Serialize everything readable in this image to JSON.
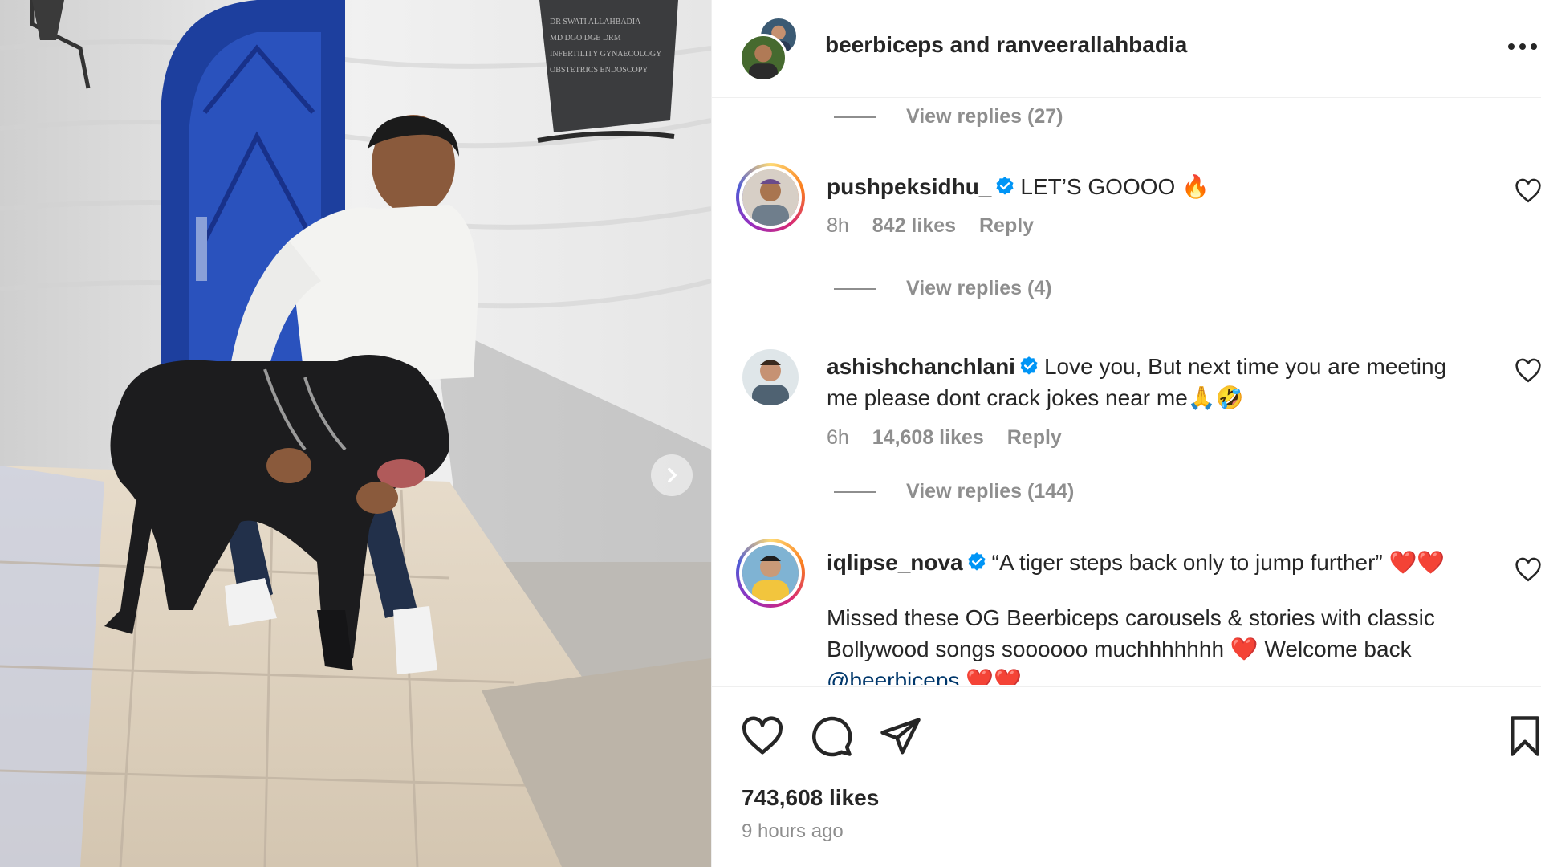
{
  "post": {
    "owner": "beerbiceps and ranveerallahbadia",
    "likes": "743,608 likes",
    "time": "9 hours ago",
    "sign_text": [
      "DR SWATI ALLAHBADIA",
      "MD DGO DGE DRM",
      "INFERTILITY GYNAECOLOGY",
      "OBSTETRICS ENDOSCOPY"
    ]
  },
  "comments": {
    "replies_1": "View replies (27)",
    "c1": {
      "username": "pushpeksidhu_",
      "text": "LET’S GOOOO 🔥",
      "age": "8h",
      "likes": "842 likes",
      "reply": "Reply"
    },
    "replies_2": "View replies (4)",
    "c2": {
      "username": "ashishchanchlani",
      "text_line1": "Love you, But next time you are meeting",
      "text_line2": "me please dont crack jokes near me🙏🤣",
      "age": "6h",
      "likes": "14,608 likes",
      "reply": "Reply"
    },
    "replies_3": "View replies (144)",
    "c3": {
      "username": "iqlipse_nova",
      "text": "“A tiger steps back only to jump further”",
      "hearts": "❤️❤️",
      "line2": "Missed these OG Beerbiceps carousels & stories with classic",
      "line3a": "Bollywood songs soooooo muchhhhhhh",
      "line3b": "Welcome back",
      "mention": "@beerbiceps"
    }
  },
  "icons": {
    "more": "more-options-icon",
    "verified": "verified-badge-icon",
    "like": "heart-icon",
    "comment": "comment-icon",
    "share": "share-icon",
    "save": "bookmark-icon",
    "next": "chevron-right-icon"
  },
  "colors": {
    "verified": "#0095f6",
    "muted": "#8e8e8e",
    "text": "#262626",
    "door": "#2246a8"
  }
}
